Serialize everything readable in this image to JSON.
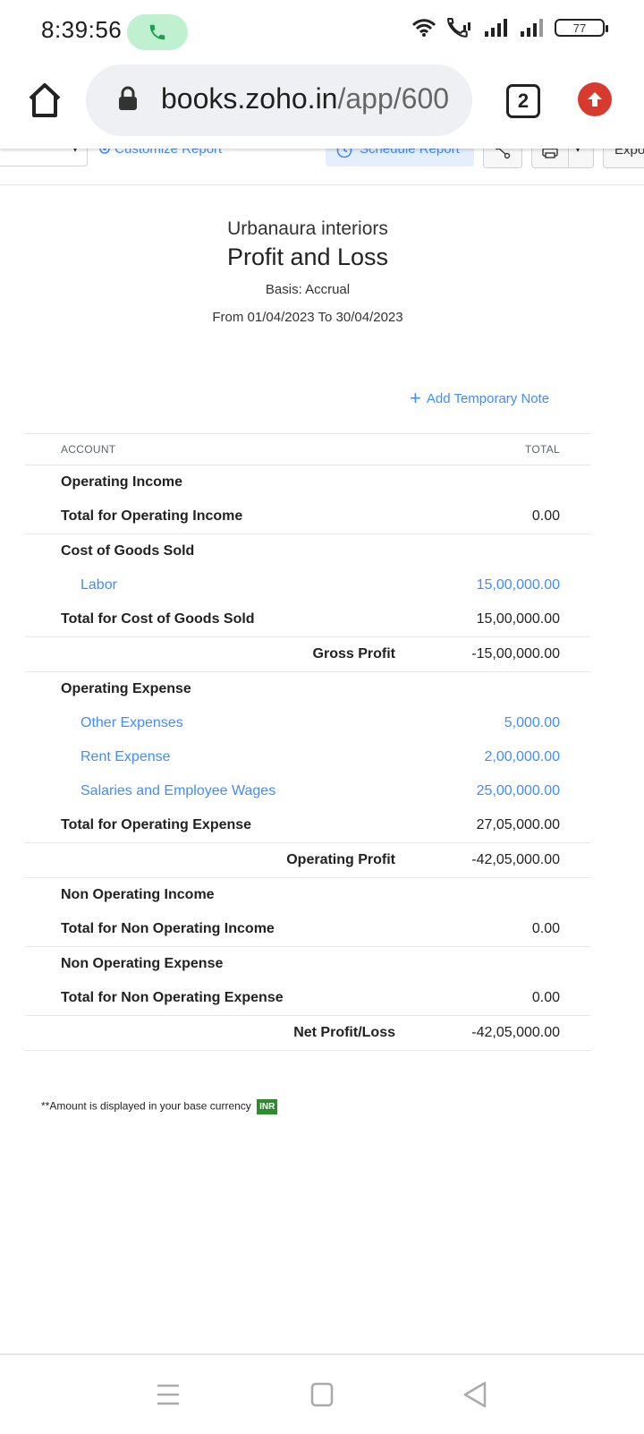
{
  "status_bar": {
    "time": "8:39:56",
    "battery": "77",
    "icons": [
      "phone-call-icon",
      "wifi-icon",
      "wifi-calling-icon",
      "signal-icon",
      "signal-icon",
      "battery-icon"
    ]
  },
  "browser": {
    "url_domain": "books.zoho.in",
    "url_path": "/app/600",
    "tab_count": "2"
  },
  "toolbar": {
    "customize_label": "Customize Report",
    "schedule_label": "Schedule Report",
    "export_label": "Expo"
  },
  "report": {
    "org_name": "Urbanaura interiors",
    "title": "Profit and Loss",
    "basis": "Basis: Accrual",
    "date_range": "From 01/04/2023 To 30/04/2023",
    "add_note_label": "Add Temporary Note",
    "col_account": "ACCOUNT",
    "col_total": "TOTAL",
    "rows": [
      {
        "label": "Operating Income",
        "value": ""
      },
      {
        "label": "Total for Operating Income",
        "value": "0.00"
      },
      {
        "label": "Cost of Goods Sold",
        "value": ""
      },
      {
        "label": "Labor",
        "value": "15,00,000.00"
      },
      {
        "label": "Total for Cost of Goods Sold",
        "value": "15,00,000.00"
      },
      {
        "label": "Gross Profit",
        "value": "-15,00,000.00"
      },
      {
        "label": "Operating Expense",
        "value": ""
      },
      {
        "label": "Other Expenses",
        "value": "5,000.00"
      },
      {
        "label": "Rent Expense",
        "value": "2,00,000.00"
      },
      {
        "label": "Salaries and Employee Wages",
        "value": "25,00,000.00"
      },
      {
        "label": "Total for Operating Expense",
        "value": "27,05,000.00"
      },
      {
        "label": "Operating Profit",
        "value": "-42,05,000.00"
      },
      {
        "label": "Non Operating Income",
        "value": ""
      },
      {
        "label": "Total for Non Operating Income",
        "value": "0.00"
      },
      {
        "label": "Non Operating Expense",
        "value": ""
      },
      {
        "label": "Total for Non Operating Expense",
        "value": "0.00"
      },
      {
        "label": "Net Profit/Loss",
        "value": "-42,05,000.00"
      }
    ],
    "footnote": "**Amount is displayed in your base currency",
    "currency": "INR"
  },
  "colors": {
    "link": "#408dfb",
    "danger": "#d83b2e",
    "currency_badge": "#2e8b2e"
  }
}
